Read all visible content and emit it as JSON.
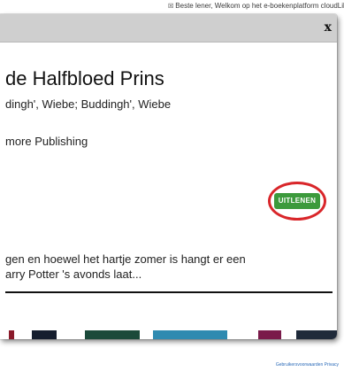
{
  "notice": {
    "icon": "x-box-icon",
    "text": "Beste lener, Welkom op het e-boekenplatform cloudLibrary. Op dit platform le"
  },
  "modal": {
    "close_label": "x",
    "title": "de Halfbloed Prins",
    "authors": "dingh', Wiebe; Buddingh', Wiebe",
    "publisher": "more Publishing",
    "loan_button": "UITLENEN",
    "highlight_color": "#d9262a",
    "button_color": "#3c9a3c",
    "description_line1": "gen en hoewel het hartje zomer is hangt er een",
    "description_line2": "arry Potter 's avonds laat...",
    "related_covers": [
      {
        "color": "#8a1a2a"
      },
      {
        "color": "#151e2e"
      },
      {
        "color": "#1b4a3a"
      },
      {
        "color": "#2f8ab0"
      },
      {
        "color": "#7a1a4a"
      },
      {
        "color": "#1f2a3a"
      }
    ]
  },
  "footer": {
    "link": "Gebruikersvoorwaarden Privacy"
  }
}
